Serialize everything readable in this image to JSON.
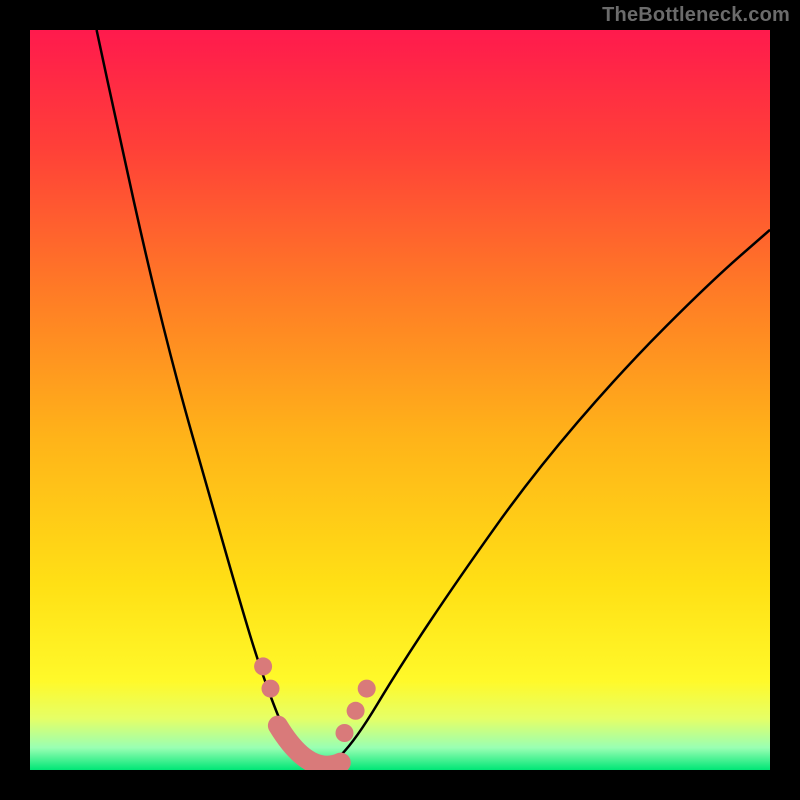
{
  "attribution": "TheBottleneck.com",
  "colors": {
    "gradient": {
      "c0": "#ff1a4d",
      "c1": "#ff4038",
      "c2": "#ff7a26",
      "c3": "#ffb319",
      "c4": "#ffe015",
      "c5": "#fff92a",
      "c6": "#e6ff66",
      "c7": "#99ffb3",
      "c8": "#00e676"
    },
    "curve": "#000000",
    "marker": "#d97a7a"
  },
  "chart_data": {
    "type": "line",
    "title": "",
    "xlabel": "",
    "ylabel": "",
    "xlim": [
      0,
      100
    ],
    "ylim": [
      0,
      100
    ],
    "grid": false,
    "series": [
      {
        "name": "bottleneck-curve",
        "points": [
          {
            "x": 9,
            "y": 100
          },
          {
            "x": 12,
            "y": 86
          },
          {
            "x": 16,
            "y": 68
          },
          {
            "x": 20,
            "y": 52
          },
          {
            "x": 24,
            "y": 38
          },
          {
            "x": 28,
            "y": 24
          },
          {
            "x": 31,
            "y": 14
          },
          {
            "x": 34,
            "y": 6
          },
          {
            "x": 36,
            "y": 2
          },
          {
            "x": 38,
            "y": 0
          },
          {
            "x": 40,
            "y": 0
          },
          {
            "x": 44,
            "y": 4
          },
          {
            "x": 50,
            "y": 14
          },
          {
            "x": 58,
            "y": 26
          },
          {
            "x": 68,
            "y": 40
          },
          {
            "x": 80,
            "y": 54
          },
          {
            "x": 92,
            "y": 66
          },
          {
            "x": 100,
            "y": 73
          }
        ]
      }
    ],
    "markers": [
      {
        "x": 31.5,
        "y": 14
      },
      {
        "x": 32.5,
        "y": 11
      },
      {
        "x": 42.5,
        "y": 5
      },
      {
        "x": 44.0,
        "y": 8
      },
      {
        "x": 45.5,
        "y": 11
      }
    ],
    "optimum_band": {
      "x_start": 33.5,
      "y_start": 6,
      "x_end": 42.0,
      "y_end": 1
    }
  }
}
